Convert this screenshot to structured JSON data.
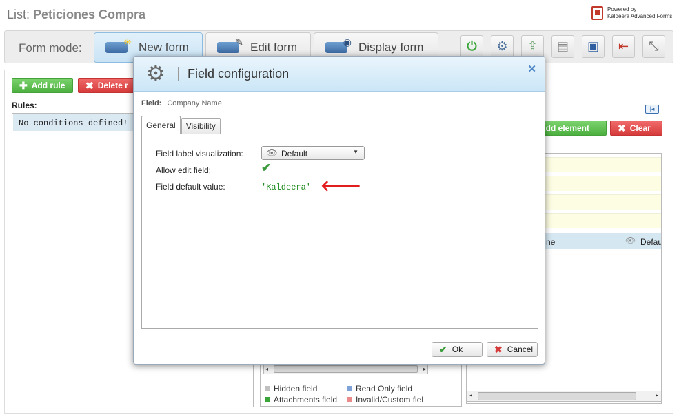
{
  "header": {
    "list_prefix": "List: ",
    "list_name": "Peticiones Compra",
    "powered_line1": "Powered by",
    "powered_line2": "Kaldeera Advanced Forms"
  },
  "toolbar": {
    "form_mode_label": "Form mode:",
    "modes": [
      {
        "label": "New form",
        "active": true
      },
      {
        "label": "Edit form",
        "active": false
      },
      {
        "label": "Display form",
        "active": false
      }
    ],
    "tools": [
      "power-icon",
      "settings-icon",
      "export-icon",
      "import-icon",
      "save-icon",
      "exit-icon",
      "collapse-icon"
    ]
  },
  "rules_panel": {
    "add_rule": "Add rule",
    "delete_rule": "Delete r",
    "rules_label": "Rules:",
    "empty_text": "No conditions defined!"
  },
  "elements_panel": {
    "add_element": "Add element",
    "clear": "Clear",
    "selected_row_name": "ne",
    "selected_row_mode": "Defau"
  },
  "legend": {
    "hidden": "Hidden field",
    "readonly": "Read Only field",
    "attachments": "Attachments field",
    "invalid": "Invalid/Custom fiel"
  },
  "colors": {
    "hidden": "#c0c0c0",
    "readonly": "#7fa3d9",
    "attachments": "#3aa63a",
    "invalid": "#ea8a8a",
    "accent_green": "#4caf3f",
    "accent_red": "#d63b3b"
  },
  "dialog": {
    "title": "Field configuration",
    "field_label": "Field:",
    "field_value": "Company Name",
    "tabs": [
      "General",
      "Visibility"
    ],
    "label_visualization_label": "Field label visualization:",
    "label_visualization_value": "Default",
    "allow_edit_label": "Allow edit field:",
    "allow_edit_checked": true,
    "default_value_label": "Field default value:",
    "default_value": "'Kaldeera'",
    "ok": "Ok",
    "cancel": "Cancel"
  }
}
